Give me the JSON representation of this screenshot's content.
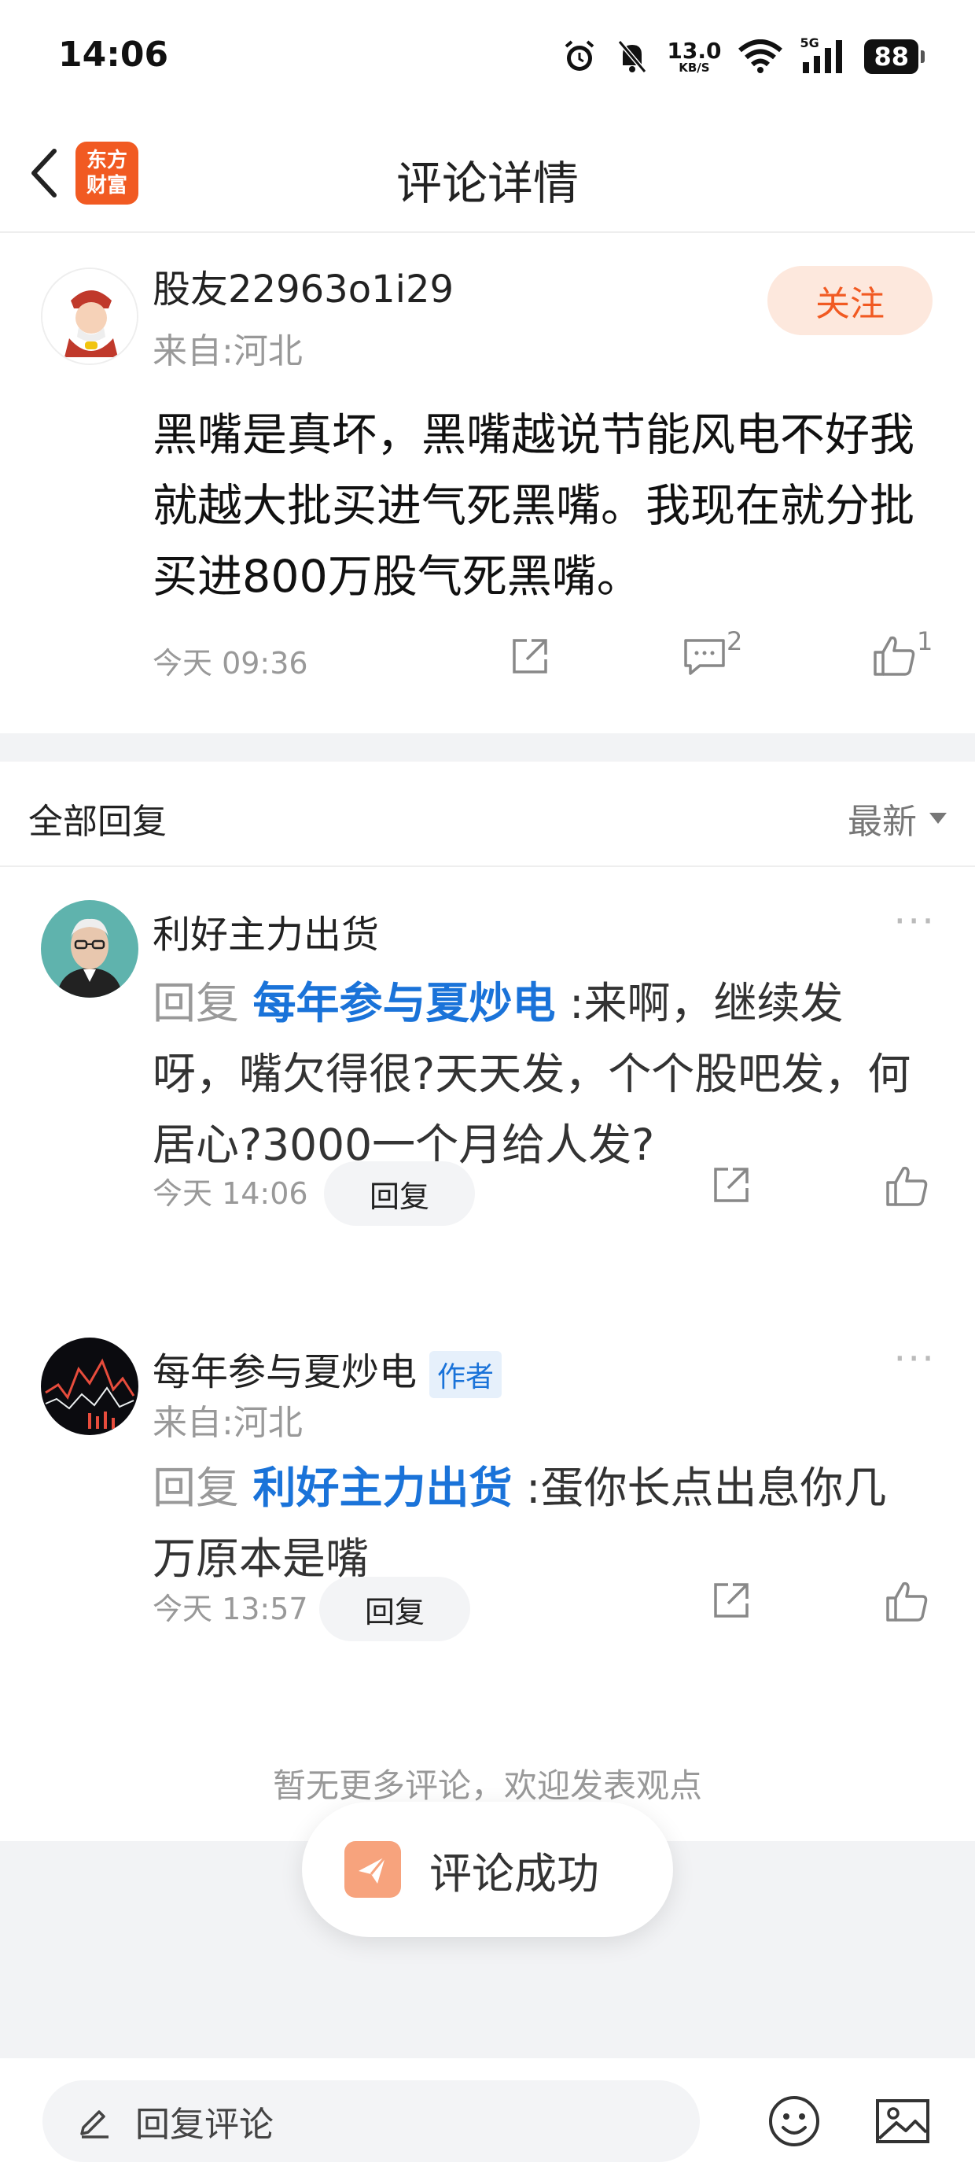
{
  "status_bar": {
    "time": "14:06",
    "net_speed_value": "13.0",
    "net_speed_unit": "KB/S",
    "signal_label": "5G",
    "battery": "88",
    "icons": [
      "alarm-icon",
      "mute-bell-icon",
      "wifi-icon",
      "cell-signal-icon",
      "battery-icon"
    ]
  },
  "nav": {
    "title": "评论详情",
    "logo_line1": "东方",
    "logo_line2": "财富"
  },
  "main_comment": {
    "username": "股友22963o1i29",
    "location": "来自:河北",
    "follow_label": "关注",
    "text": "黑嘴是真坏，黑嘴越说节能风电不好我就越大批买进气死黑嘴。我现在就分批买进800万股气死黑嘴。",
    "time": "今天 09:36",
    "comment_count": "2",
    "like_count": "1"
  },
  "replies_header": {
    "title": "全部回复",
    "sort_label": "最新"
  },
  "replies": [
    {
      "username": "利好主力出货",
      "reply_prefix": "回复",
      "mention": "每年参与夏炒电",
      "separator": ":",
      "text": "来啊，继续发呀，嘴欠得很?天天发，个个股吧发，何居心?3000一个月给人发?",
      "time": "今天 14:06",
      "reply_label": "回复",
      "more": "···"
    },
    {
      "username": "每年参与夏炒电",
      "badge": "作者",
      "location": "来自:河北",
      "reply_prefix": "回复",
      "mention": "利好主力出货",
      "separator": ":",
      "text": "蛋你长点出息你几万原本是嘴",
      "time": "今天 13:57",
      "reply_label": "回复",
      "more": "···"
    }
  ],
  "no_more_text": "暂无更多评论，欢迎发表观点",
  "toast": {
    "text": "评论成功"
  },
  "bottom_bar": {
    "input_placeholder": "回复评论"
  },
  "colors": {
    "accent": "#f15a22",
    "link": "#1a73d9",
    "muted": "#999999"
  }
}
